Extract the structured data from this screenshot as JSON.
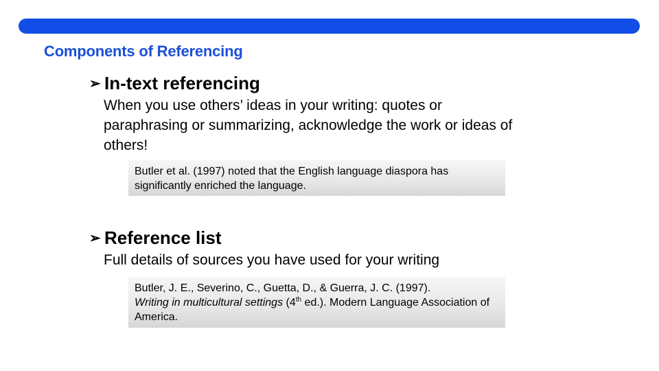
{
  "slide": {
    "title": "Components of Referencing",
    "accent_color": "#114de6",
    "sections": [
      {
        "bullet_icon": "arrowhead-bullet",
        "heading": "In-text referencing",
        "description": "When you use others’ ideas in your writing: quotes or paraphrasing or summarizing, acknowledge the work or ideas of others!",
        "example": {
          "text": "Butler et al. (1997) noted that the English language diaspora has significantly enriched the language."
        }
      },
      {
        "bullet_icon": "arrowhead-bullet",
        "heading": "Reference list",
        "description": "Full details of sources you have used for your writing",
        "example": {
          "authors": "Butler, J. E., Severino, C., Guetta, D., & Guerra, J. C. (1997).",
          "book_title": "Writing in multicultural settings",
          "edition_open": " (4",
          "edition_sup": "th",
          "edition_close": " ed.). Modern Language Association of America."
        }
      }
    ]
  }
}
